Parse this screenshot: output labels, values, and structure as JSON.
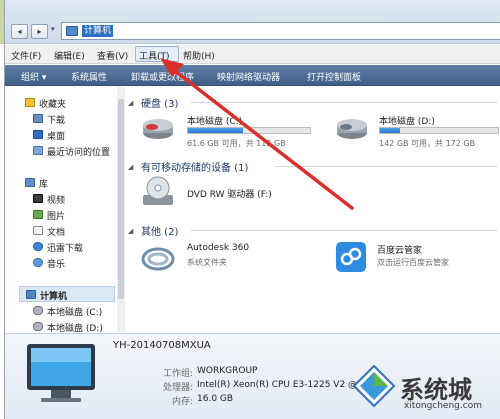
{
  "address": {
    "path": "计算机"
  },
  "menubar": {
    "items": [
      "文件(F)",
      "编辑(E)",
      "查看(V)",
      "工具(T)",
      "帮助(H)"
    ]
  },
  "commandbar": {
    "items": [
      "组织 ▾",
      "系统属性",
      "卸载或更改程序",
      "映射网络驱动器",
      "打开控制面板"
    ]
  },
  "navpane": {
    "favorites_header": "收藏夹",
    "favorites": [
      "下载",
      "桌面",
      "最近访问的位置"
    ],
    "library_header": "库",
    "library": [
      "视频",
      "图片",
      "文档",
      "迅雷下载",
      "音乐"
    ],
    "computer_header": "计算机",
    "computer": [
      "本地磁盘 (C:)",
      "本地磁盘 (D:)"
    ]
  },
  "content": {
    "hdd_group": "硬盘 (3)",
    "drives": [
      {
        "name": "本地磁盘 (C:)",
        "free": "61.6 GB 可用，共 112 GB",
        "used_fraction": 0.45
      },
      {
        "name": "本地磁盘 (D:)",
        "free": "142 GB 可用，共 172 GB",
        "used_fraction": 0.17
      }
    ],
    "removable_group": "有可移动存储的设备 (1)",
    "dvd": {
      "name": "DVD RW 驱动器 (F:)"
    },
    "other_group": "其他 (2)",
    "others": [
      {
        "name": "Autodesk 360",
        "sub": "系统文件夹"
      },
      {
        "name": "百度云管家",
        "sub": "双击运行百度云管家"
      }
    ]
  },
  "details": {
    "computer_name": "YH-20140708MXUA",
    "rows": [
      {
        "label": "工作组:",
        "value": "WORKGROUP"
      },
      {
        "label": "处理器:",
        "value": "Intel(R) Xeon(R) CPU E3-1225 V2 @ 3.20..."
      },
      {
        "label": "内存:",
        "value": "16.0 GB"
      }
    ]
  },
  "watermark": {
    "title": "系统城",
    "url": "xitongcheng.com"
  },
  "colors": {
    "accent": "#2f6fc0",
    "annotation_arrow": "#d9302c",
    "cmdbar": "#4d6d96"
  }
}
